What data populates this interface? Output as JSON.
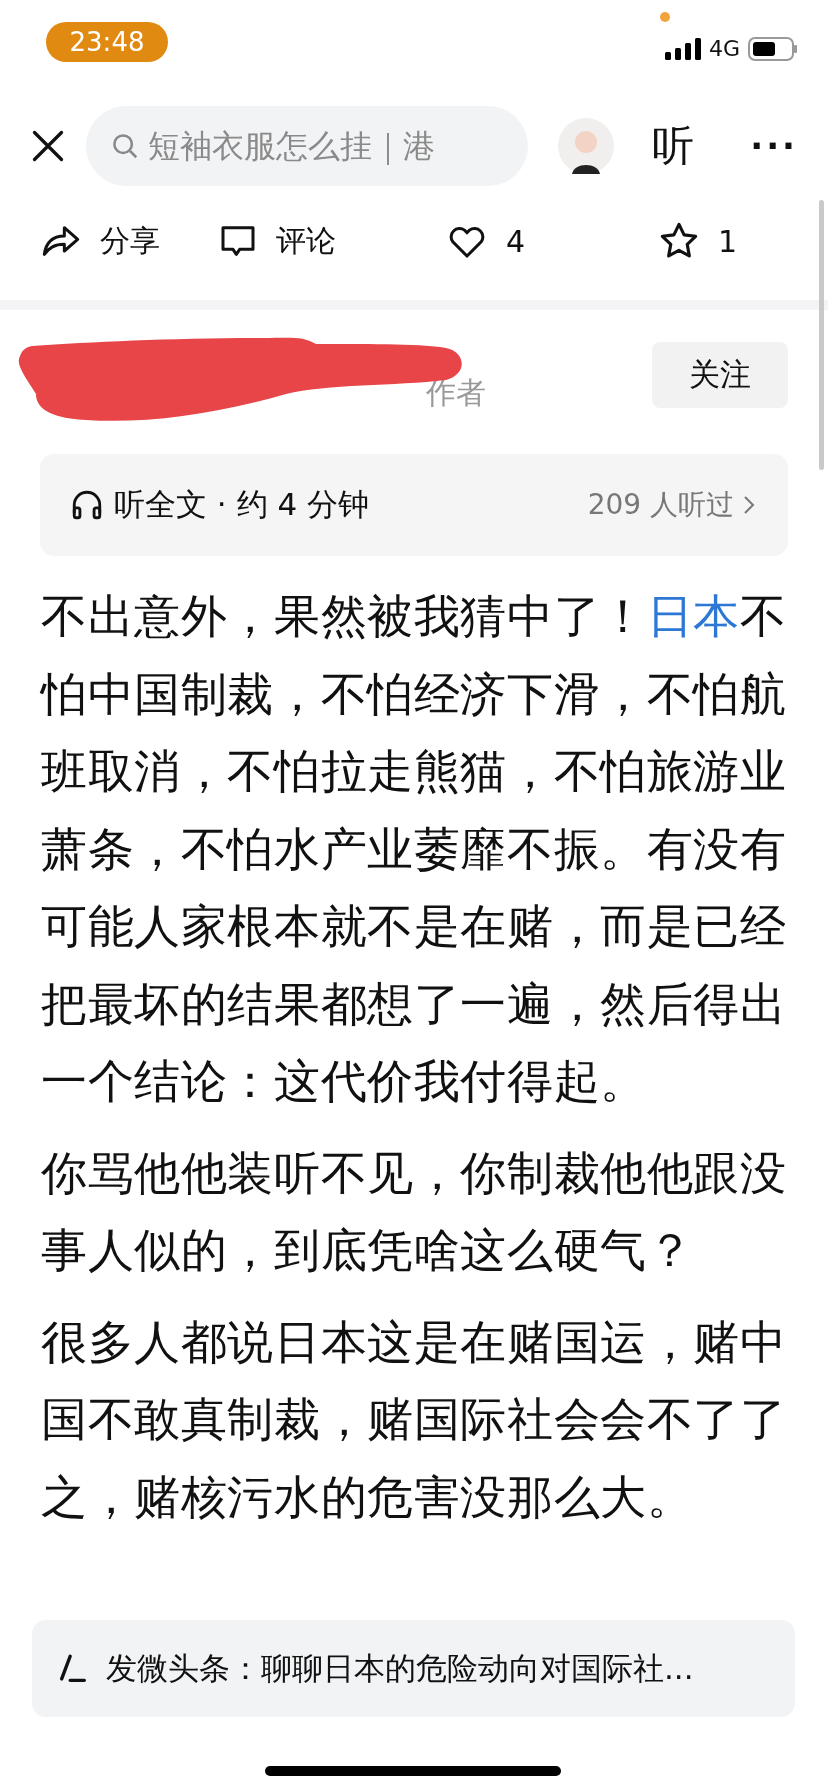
{
  "status_bar": {
    "time": "23:48",
    "network": "4G"
  },
  "nav": {
    "search": {
      "placeholder": "短袖衣服怎么挂｜港"
    },
    "listen_label": "听",
    "more_label": "···"
  },
  "actions": [
    {
      "kind": "share",
      "label": "分享"
    },
    {
      "kind": "comment",
      "label": "评论"
    },
    {
      "kind": "like",
      "label": "4"
    },
    {
      "kind": "favorite",
      "label": "1"
    }
  ],
  "author": {
    "subtitle": "作者",
    "follow_label": "关注"
  },
  "listen_bar": {
    "title": "听全文 · 约 4 分钟",
    "count": "209 人听过"
  },
  "article": {
    "paragraphs": [
      [
        {
          "text": "不出意外，果然被我猜中了！",
          "link": false
        },
        {
          "text": "日本",
          "link": true
        },
        {
          "text": "不怕中国制裁，不怕经济下滑，不怕航班取消，不怕拉走熊猫，不怕旅游业萧条，不怕水产业萎靡不振。有没有可能人家根本就不是在赌，而是已经把最坏的结果都想了一遍，然后得出一个结论：这代价我付得起。",
          "link": false
        }
      ],
      [
        {
          "text": "你骂他他装听不见，你制裁他他跟没事人似的，到底凭啥这么硬气？",
          "link": false
        }
      ],
      [
        {
          "text": "很多人都说日本这是在赌国运，赌中国不敢真制裁，赌国际社会会不了了之，赌核污水的危害没那么大。",
          "link": false
        }
      ]
    ]
  },
  "compose_bar": {
    "text": "发微头条：聊聊日本的危险动向对国际社..."
  }
}
